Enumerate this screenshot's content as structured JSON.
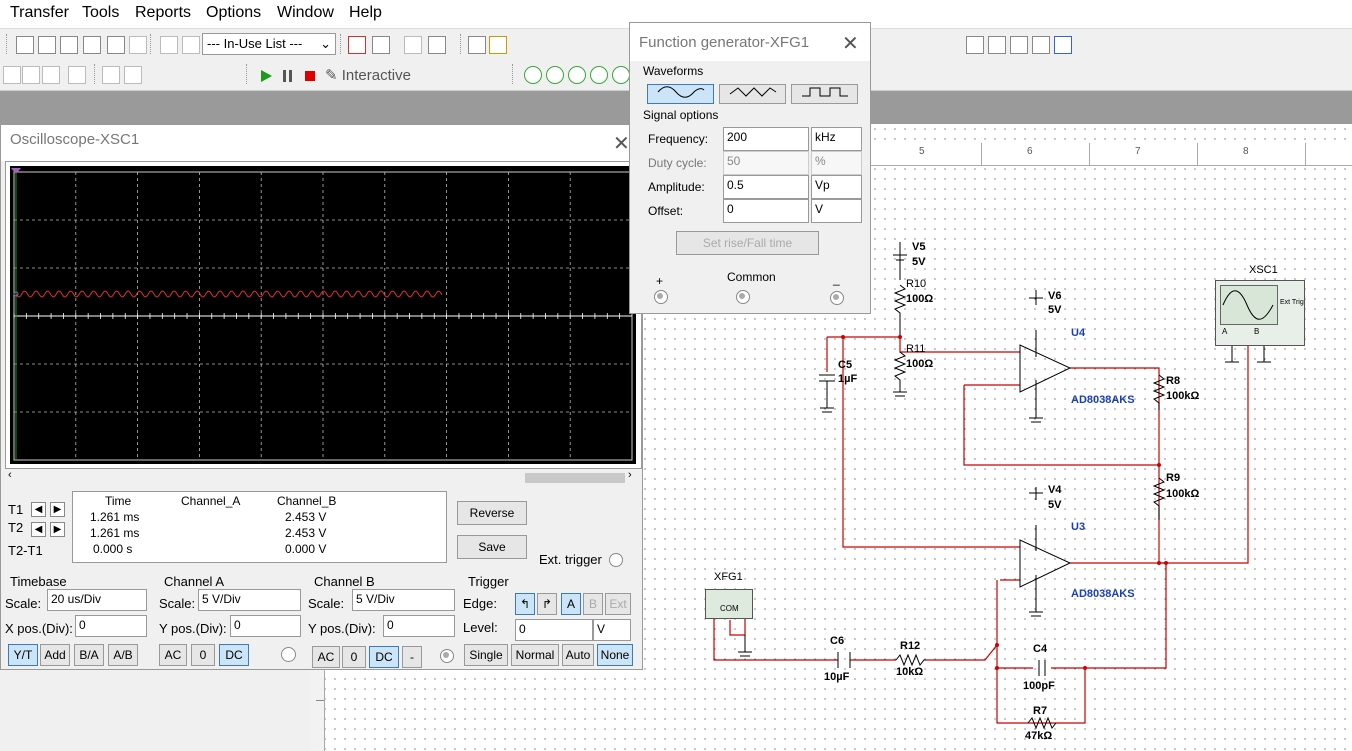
{
  "menu": [
    "Transfer",
    "Tools",
    "Reports",
    "Options",
    "Window",
    "Help"
  ],
  "toolbar": {
    "in_use_list": "--- In-Use List ---",
    "mode_label": "Interactive"
  },
  "ruler": [
    "5",
    "6",
    "7",
    "8"
  ],
  "oscilloscope": {
    "title": "Oscilloscope-XSC1",
    "trace_color": "#e03030",
    "grid": {
      "columns": 10,
      "rows": 6
    },
    "cursor_table": {
      "t1_label": "T1",
      "t2_label": "T2",
      "t2t1_label": "T2-T1",
      "headers": [
        "Time",
        "Channel_A",
        "Channel_B"
      ],
      "rows": [
        [
          "1.261 ms",
          "",
          "2.453 V"
        ],
        [
          "1.261 ms",
          "",
          "2.453 V"
        ],
        [
          "0.000 s",
          "",
          "0.000 V"
        ]
      ]
    },
    "reverse_label": "Reverse",
    "save_label": "Save",
    "ext_trigger_label": "Ext. trigger",
    "timebase": {
      "title": "Timebase",
      "scale_label": "Scale:",
      "scale": "20 us/Div",
      "xpos_label": "X pos.(Div):",
      "xpos": "0",
      "buttons": [
        "Y/T",
        "Add",
        "B/A",
        "A/B"
      ],
      "selected": "Y/T"
    },
    "channel_a": {
      "title": "Channel A",
      "scale_label": "Scale:",
      "scale": "5  V/Div",
      "ypos_label": "Y pos.(Div):",
      "ypos": "0",
      "buttons": [
        "AC",
        "0",
        "DC"
      ],
      "selected": "DC"
    },
    "channel_b": {
      "title": "Channel B",
      "scale_label": "Scale:",
      "scale": "5  V/Div",
      "ypos_label": "Y pos.(Div):",
      "ypos": "0",
      "buttons": [
        "AC",
        "0",
        "DC",
        "-"
      ],
      "selected": "DC"
    },
    "trigger": {
      "title": "Trigger",
      "edge_label": "Edge:",
      "edge_buttons": [
        "A",
        "B",
        "Ext"
      ],
      "level_label": "Level:",
      "level": "0",
      "level_unit": "V",
      "mode_buttons": [
        "Single",
        "Normal",
        "Auto",
        "None"
      ],
      "selected_mode": "None"
    }
  },
  "function_generator": {
    "title": "Function generator-XFG1",
    "waveforms_label": "Waveforms",
    "selected_waveform": "sine",
    "signal_options_label": "Signal options",
    "frequency": {
      "label": "Frequency:",
      "value": "200",
      "unit": "kHz"
    },
    "duty_cycle": {
      "label": "Duty cycle:",
      "value": "50",
      "unit": "%"
    },
    "amplitude": {
      "label": "Amplitude:",
      "value": "0.5",
      "unit": "Vp"
    },
    "offset": {
      "label": "Offset:",
      "value": "0",
      "unit": "V"
    },
    "rise_fall_label": "Set rise/Fall time",
    "terminal_plus": "+",
    "terminal_common": "Common",
    "terminal_minus": "_"
  },
  "schematic": {
    "wire_color": "#cc0000",
    "components": {
      "v5": {
        "name": "V5",
        "value": "5V"
      },
      "v6": {
        "name": "V6",
        "value": "5V"
      },
      "v4": {
        "name": "V4",
        "value": "5V"
      },
      "r10": {
        "name": "R10",
        "value": "100Ω"
      },
      "r11": {
        "name": "R11",
        "value": "100Ω"
      },
      "c5": {
        "name": "C5",
        "value": "1µF"
      },
      "u4": {
        "name": "U4",
        "part": "AD8038AKS"
      },
      "u3": {
        "name": "U3",
        "part": "AD8038AKS"
      },
      "r8": {
        "name": "R8",
        "value": "100kΩ"
      },
      "r9": {
        "name": "R9",
        "value": "100kΩ"
      },
      "xsc1": {
        "name": "XSC1",
        "ext_trig": "Ext Trig",
        "a": "A",
        "b": "B"
      },
      "xfg1": {
        "name": "XFG1",
        "com": "COM"
      },
      "c6": {
        "name": "C6",
        "value": "10µF"
      },
      "r12": {
        "name": "R12",
        "value": "10kΩ"
      },
      "c4": {
        "name": "C4",
        "value": "100pF"
      },
      "r7": {
        "name": "R7",
        "value": "47kΩ"
      }
    }
  }
}
